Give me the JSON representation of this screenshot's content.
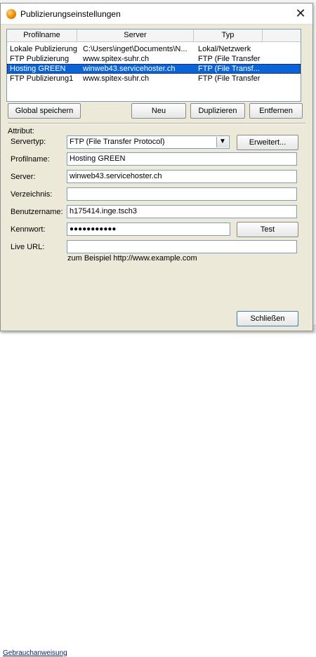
{
  "dialog": {
    "title": "Publizierungseinstellungen",
    "close_label": "✕"
  },
  "profile_list": {
    "columns": [
      "Profilname",
      "Server",
      "Typ"
    ],
    "rows": [
      {
        "name": "Lokale Publizierung",
        "server": "C:\\Users\\inget\\Documents\\N...",
        "type": "Lokal/Netzwerk"
      },
      {
        "name": "FTP Publizierung",
        "server": "www.spitex-suhr.ch",
        "type": "FTP (File Transfer"
      },
      {
        "name": "Hosting GREEN",
        "server": "winweb43.servicehoster.ch",
        "type": "FTP (File Transf..."
      },
      {
        "name": "FTP Publizierung1",
        "server": "www.spitex-suhr.ch",
        "type": "FTP (File Transfer"
      }
    ],
    "selected_index": 2
  },
  "buttons": {
    "global_save": "Global speichern",
    "new": "Neu",
    "duplicate": "Duplizieren",
    "remove": "Entfernen",
    "advanced": "Erweitert...",
    "test": "Test",
    "close": "Schließen"
  },
  "attributes": {
    "section_label": "Attribut:",
    "server_type_label": "Servertyp:",
    "server_type_value": "FTP (File Transfer Protocol)",
    "profile_name_label": "Profilname:",
    "profile_name_value": "Hosting GREEN",
    "server_label": "Server:",
    "server_value": "winweb43.servicehoster.ch",
    "directory_label": "Verzeichnis:",
    "directory_value": "",
    "username_label": "Benutzername:",
    "username_value": "h175414.inge.tsch3",
    "password_label": "Kennwort:",
    "password_value": "●●●●●●●●●●●",
    "live_url_label": "Live URL:",
    "live_url_value": "",
    "example_hint": "zum Beispiel http://www.example.com"
  },
  "background": {
    "link_text": "Gebrauchanweisung"
  },
  "colors": {
    "dialog_bg": "#ece9d8",
    "selection": "#0a64d8"
  }
}
